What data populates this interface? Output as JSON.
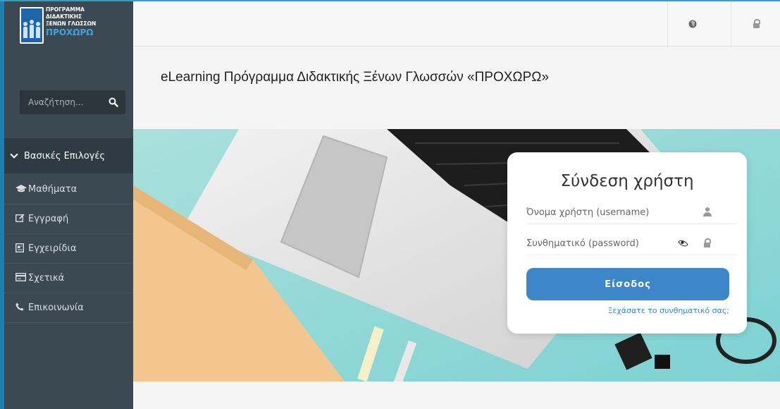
{
  "logo": {
    "line1": "ΠΡΟΓΡΑΜΜΑ",
    "line2": "ΔΙΔΑΚΤΙΚΗΣ",
    "line3": "ΞΕΝΩΝ ΓΛΩΣΣΩΝ",
    "line4": "ΠΡΟΧΩΡΩ"
  },
  "search": {
    "placeholder": "Αναζήτηση..."
  },
  "sidebar": {
    "section_title": "Βασικές Επιλογές",
    "items": [
      {
        "label": "Μαθήματα",
        "icon": "graduation-cap-icon"
      },
      {
        "label": "Εγγραφή",
        "icon": "edit-icon"
      },
      {
        "label": "Εγχειρίδια",
        "icon": "document-icon"
      },
      {
        "label": "Σχετικά",
        "icon": "card-icon"
      },
      {
        "label": "Επικοινωνία",
        "icon": "phone-icon"
      }
    ]
  },
  "topbar": {
    "language_icon": "globe-icon",
    "login_icon": "lock-icon"
  },
  "page": {
    "title": "eLearning Πρόγραμμα Διδακτικής Ξένων Γλωσσών «ΠΡΟΧΩΡΩ»"
  },
  "login": {
    "title": "Σύνδεση χρήστη",
    "username_placeholder": "Όνομα χρήστη (username)",
    "password_placeholder": "Συνθηματικό (password)",
    "submit_label": "Είσοδος",
    "forgot_link": "Ξεχάσατε το συνθηματικό σας;"
  },
  "colors": {
    "sidebar_bg": "#3b4a52",
    "accent": "#3d87c8",
    "link": "#2f8bd1",
    "hero_bg": "#8fd6d6"
  }
}
